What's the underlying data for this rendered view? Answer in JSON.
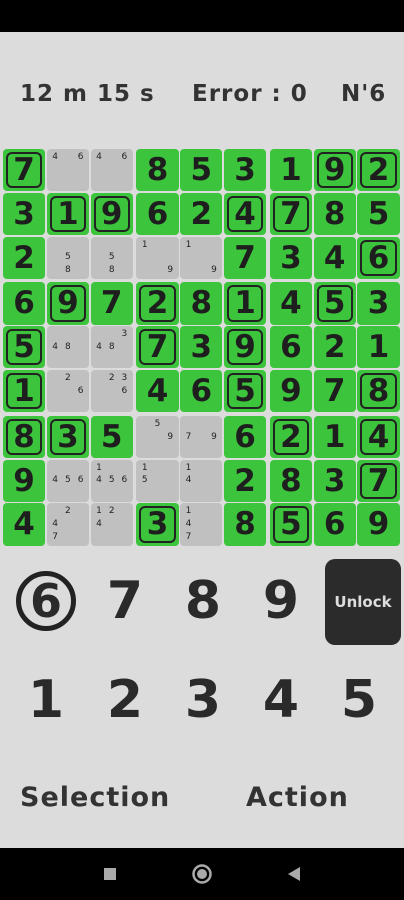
{
  "stats": {
    "timer": "12 m 15 s",
    "errors": "Error : 0",
    "level": "N'6"
  },
  "board": [
    [
      {
        "v": "7",
        "t": "given"
      },
      {
        "notes": [
          "4",
          "",
          "6",
          "",
          "",
          "",
          "",
          "",
          ""
        ]
      },
      {
        "notes": [
          "4",
          "",
          "6",
          "",
          "",
          "",
          "",
          "",
          ""
        ]
      },
      {
        "v": "8",
        "t": "green"
      },
      {
        "v": "5",
        "t": "green"
      },
      {
        "v": "3",
        "t": "green"
      },
      {
        "v": "1",
        "t": "green"
      },
      {
        "v": "9",
        "t": "given"
      },
      {
        "v": "2",
        "t": "given"
      }
    ],
    [
      {
        "v": "3",
        "t": "green"
      },
      {
        "v": "1",
        "t": "given"
      },
      {
        "v": "9",
        "t": "given"
      },
      {
        "v": "6",
        "t": "green"
      },
      {
        "v": "2",
        "t": "green"
      },
      {
        "v": "4",
        "t": "given"
      },
      {
        "v": "7",
        "t": "given"
      },
      {
        "v": "8",
        "t": "green"
      },
      {
        "v": "5",
        "t": "green"
      }
    ],
    [
      {
        "v": "2",
        "t": "green"
      },
      {
        "notes": [
          "",
          "",
          "",
          "",
          "5",
          "",
          "",
          "8",
          ""
        ]
      },
      {
        "notes": [
          "",
          "",
          "",
          "",
          "5",
          "",
          "",
          "8",
          ""
        ]
      },
      {
        "notes": [
          "1",
          "",
          "",
          "",
          "",
          "",
          "",
          "",
          "9"
        ]
      },
      {
        "notes": [
          "1",
          "",
          "",
          "",
          "",
          "",
          "",
          "",
          "9"
        ]
      },
      {
        "v": "7",
        "t": "green"
      },
      {
        "v": "3",
        "t": "green"
      },
      {
        "v": "4",
        "t": "green"
      },
      {
        "v": "6",
        "t": "given"
      }
    ],
    [
      {
        "v": "6",
        "t": "green"
      },
      {
        "v": "9",
        "t": "given"
      },
      {
        "v": "7",
        "t": "green"
      },
      {
        "v": "2",
        "t": "given"
      },
      {
        "v": "8",
        "t": "green"
      },
      {
        "v": "1",
        "t": "given"
      },
      {
        "v": "4",
        "t": "green"
      },
      {
        "v": "5",
        "t": "given"
      },
      {
        "v": "3",
        "t": "green"
      }
    ],
    [
      {
        "v": "5",
        "t": "given"
      },
      {
        "notes": [
          "",
          "",
          "",
          "4",
          "8",
          "",
          "",
          "",
          ""
        ]
      },
      {
        "notes": [
          "",
          "",
          "3",
          "4",
          "8",
          "",
          "",
          "",
          ""
        ]
      },
      {
        "v": "7",
        "t": "given"
      },
      {
        "v": "3",
        "t": "green"
      },
      {
        "v": "9",
        "t": "given"
      },
      {
        "v": "6",
        "t": "green"
      },
      {
        "v": "2",
        "t": "green"
      },
      {
        "v": "1",
        "t": "green"
      }
    ],
    [
      {
        "v": "1",
        "t": "given"
      },
      {
        "notes": [
          "",
          "2",
          "",
          "",
          "",
          "6",
          "",
          "",
          ""
        ]
      },
      {
        "notes": [
          "",
          "2",
          "3",
          "",
          "",
          "6",
          "",
          "",
          ""
        ]
      },
      {
        "v": "4",
        "t": "green"
      },
      {
        "v": "6",
        "t": "green"
      },
      {
        "v": "5",
        "t": "given"
      },
      {
        "v": "9",
        "t": "green"
      },
      {
        "v": "7",
        "t": "green"
      },
      {
        "v": "8",
        "t": "given"
      }
    ],
    [
      {
        "v": "8",
        "t": "given"
      },
      {
        "v": "3",
        "t": "given"
      },
      {
        "v": "5",
        "t": "green"
      },
      {
        "notes": [
          "",
          "5",
          "",
          "",
          "",
          "9",
          "",
          "",
          ""
        ]
      },
      {
        "notes": [
          "",
          "",
          "",
          "7",
          "",
          "9",
          "",
          "",
          ""
        ]
      },
      {
        "v": "6",
        "t": "green"
      },
      {
        "v": "2",
        "t": "given"
      },
      {
        "v": "1",
        "t": "green"
      },
      {
        "v": "4",
        "t": "given"
      }
    ],
    [
      {
        "v": "9",
        "t": "green"
      },
      {
        "notes": [
          "",
          "",
          "",
          "4",
          "5",
          "6",
          "",
          "",
          ""
        ]
      },
      {
        "notes": [
          "1",
          "",
          "",
          "4",
          "5",
          "6",
          "",
          "",
          ""
        ]
      },
      {
        "notes": [
          "1",
          "",
          "",
          "5",
          "",
          "",
          "",
          "",
          ""
        ]
      },
      {
        "notes": [
          "1",
          "",
          "",
          "4",
          "",
          "",
          "",
          "",
          ""
        ]
      },
      {
        "v": "2",
        "t": "green"
      },
      {
        "v": "8",
        "t": "green"
      },
      {
        "v": "3",
        "t": "green"
      },
      {
        "v": "7",
        "t": "given"
      }
    ],
    [
      {
        "v": "4",
        "t": "green"
      },
      {
        "notes": [
          "",
          "2",
          "",
          "4",
          "",
          "",
          "7",
          "",
          ""
        ]
      },
      {
        "notes": [
          "1",
          "2",
          "",
          "4",
          "",
          "",
          "",
          "",
          ""
        ]
      },
      {
        "v": "3",
        "t": "given"
      },
      {
        "notes": [
          "1",
          "",
          "",
          "4",
          "",
          "",
          "7",
          "",
          ""
        ]
      },
      {
        "v": "8",
        "t": "green"
      },
      {
        "v": "5",
        "t": "given"
      },
      {
        "v": "6",
        "t": "green"
      },
      {
        "v": "9",
        "t": "green"
      }
    ]
  ],
  "keypad": {
    "row1": [
      "6",
      "7",
      "8",
      "9"
    ],
    "row2": [
      "1",
      "2",
      "3",
      "4",
      "5"
    ],
    "selected": "6",
    "unlock_label": "Unlock"
  },
  "modes": {
    "selection": "Selection",
    "action": "Action"
  },
  "colors": {
    "given": "#4682b4",
    "green": "#3cc43c",
    "gray": "#c0c0c0"
  }
}
